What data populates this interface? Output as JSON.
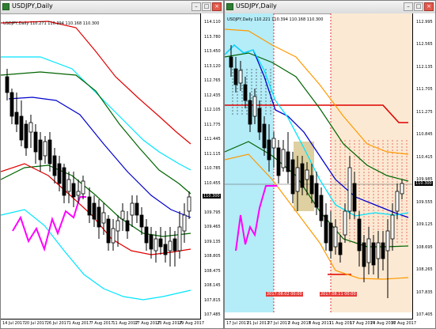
{
  "left": {
    "title": "USDJPY,Daily",
    "chart_label": "USDJPY,Daily  110.271 110.394 110.168 110.300",
    "price_ticks": [
      "114.110",
      "113.780",
      "113.450",
      "113.120",
      "112.765",
      "112.435",
      "112.105",
      "111.775",
      "111.445",
      "111.115",
      "110.785",
      "110.455",
      "110.125",
      "109.795",
      "109.465",
      "109.135",
      "108.805",
      "108.475",
      "108.145",
      "107.815",
      "107.485"
    ],
    "current_price": "110.300",
    "dates": [
      "14 Jul 2017",
      "20 Jul 2017",
      "26 Jul 2017",
      "1 Aug 2017",
      "7 Aug 2017",
      "11 Aug 2017",
      "17 Aug 2017",
      "23 Aug 2017",
      "29 Aug 2017"
    ]
  },
  "right": {
    "title": "USDJPY,Daily",
    "chart_label": "USDJPY,Daily  110.221 110.394 110.168 110.300",
    "price_ticks": [
      "112.995",
      "112.565",
      "112.135",
      "111.705",
      "111.275",
      "110.845",
      "110.415",
      "109.985",
      "109.555",
      "109.125",
      "108.695",
      "108.265",
      "107.835",
      "107.405"
    ],
    "current_price": "110.300",
    "markers": [
      "2017.08.02 00:00",
      "2017.08.11 00:00"
    ],
    "dates": [
      "17 Jul 2017",
      "21 Jul 2017",
      "27 Jul 2017",
      "2 Aug 2017",
      "8 Aug 2017",
      "11 Aug 2017",
      "17 Aug 2017",
      "24 Aug 2017",
      "30 Aug 2017"
    ]
  },
  "colors": {
    "red": "#e00000",
    "green": "#006400",
    "blue": "#0000cc",
    "cyan": "#00e5ff",
    "magenta": "#ff00ff",
    "orange": "#ff9900",
    "cyan_bg": "#b4ecf8",
    "peach_bg": "#fbe9d3",
    "khaki": "#d6c48a"
  },
  "icons": [
    "chart-window-icon",
    "minimize-icon",
    "maximize-icon",
    "close-icon"
  ]
}
